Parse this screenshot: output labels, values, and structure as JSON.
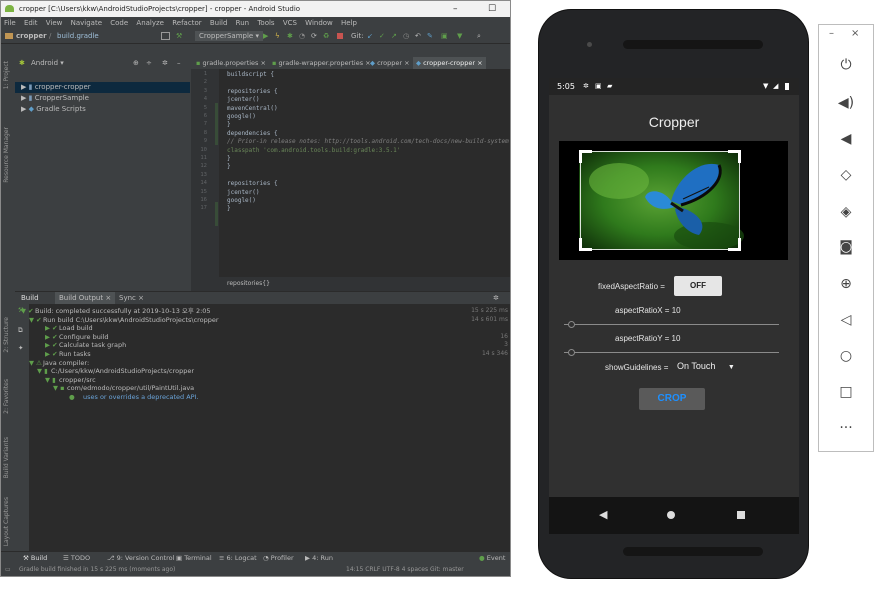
{
  "ide": {
    "window_title": "cropper [C:\\Users\\kkw\\AndroidStudioProjects\\cropper] - cropper - Android Studio",
    "minimize": "–",
    "maximize": "☐",
    "menu": [
      "File",
      "Edit",
      "View",
      "Navigate",
      "Code",
      "Analyze",
      "Refactor",
      "Build",
      "Run",
      "Tools",
      "VCS",
      "Window",
      "Help"
    ],
    "nav": {
      "project": "cropper",
      "file": "build.gradle",
      "run_config": "CropperSample"
    },
    "project_view": "Android",
    "tree": [
      {
        "label": "cropper-cropper",
        "selected": true
      },
      {
        "label": "CropperSample",
        "selected": false
      },
      {
        "label": "Gradle Scripts",
        "selected": false
      }
    ],
    "tabs": [
      "gradle.properties",
      "gradle-wrapper.properties",
      "cropper",
      "cropper-cropper"
    ],
    "side_labels": [
      "1: Project",
      "Resource Manager",
      "2: Structure",
      "2: Favorites",
      "Build Variants",
      "Layout Captures"
    ],
    "code_lines": [
      {
        "n": "1",
        "text": "buildscript {"
      },
      {
        "n": "2",
        "text": ""
      },
      {
        "n": "3",
        "text": "    repositories {"
      },
      {
        "n": "4",
        "text": "        jcenter()"
      },
      {
        "n": "5",
        "text": "        mavenCentral()"
      },
      {
        "n": "6",
        "text": "        google()"
      },
      {
        "n": "7",
        "text": "    }"
      },
      {
        "n": "8",
        "text": "    dependencies {"
      },
      {
        "n": "9",
        "text": "        // Prior-in release notes: http://tools.android.com/tech-docs/new-build-system"
      },
      {
        "n": "10",
        "text": "        classpath 'com.android.tools.build:gradle:3.5.1'"
      },
      {
        "n": "11",
        "text": "    }"
      },
      {
        "n": "12",
        "text": "}"
      },
      {
        "n": "13",
        "text": ""
      },
      {
        "n": "14",
        "text": "repositories {"
      },
      {
        "n": "15",
        "text": "    jcenter()"
      },
      {
        "n": "16",
        "text": "    google()"
      },
      {
        "n": "17",
        "text": "}"
      }
    ],
    "breadcrumb": "repositories{}",
    "build_tabs": [
      "Build",
      "Build Output",
      "Sync"
    ],
    "build_lines": [
      {
        "text": "Build: completed successfully at 2019-10-13 오후 2:05",
        "time": "15 s 225 ms"
      },
      {
        "text": "Run build C:\\Users\\kkw\\AndroidStudioProjects\\cropper",
        "time": "14 s 601 ms"
      },
      {
        "text": "Load build",
        "time": ""
      },
      {
        "text": "Configure build",
        "time": "16"
      },
      {
        "text": "Calculate task graph",
        "time": "3"
      },
      {
        "text": "Run tasks",
        "time": "14 s 346"
      },
      {
        "text": "Java compiler:",
        "time": ""
      },
      {
        "text": "C:/Users/kkw/AndroidStudioProjects/cropper",
        "time": ""
      },
      {
        "text": "cropper/src",
        "time": ""
      },
      {
        "text": "com/edmodo/cropper/util/PaintUtil.java",
        "time": ""
      },
      {
        "text": "uses or overrides a deprecated API.",
        "time": ""
      }
    ],
    "bottom_tabs": [
      "Build",
      "TODO",
      "9: Version Control",
      "Terminal",
      "6: Logcat",
      "Profiler",
      "4: Run"
    ],
    "event_log": "Event",
    "status_text": "Gradle build finished in 15 s 225 ms (moments ago)",
    "status_right": "14:15  CRLF  UTF-8  4 spaces  Git: master"
  },
  "phone": {
    "time": "5:05",
    "app_title": "Cropper",
    "fixed_aspect_label": "fixedAspectRatio =",
    "fixed_aspect_value": "OFF",
    "aspect_x_label": "aspectRatioX = 10",
    "aspect_y_label": "aspectRatioY = 10",
    "guidelines_label": "showGuidelines =",
    "guidelines_value": "On Touch",
    "crop_label": "CROP"
  },
  "emulator_toolbar": {
    "minimize": "–",
    "close": "×",
    "buttons": [
      "power-icon",
      "volume-up-icon",
      "volume-down-icon",
      "rotate-left-icon",
      "rotate-right-icon",
      "camera-icon",
      "zoom-icon",
      "back-icon",
      "home-icon",
      "overview-icon",
      "more-icon"
    ]
  },
  "colors": {
    "ide_bg": "#3c3f41",
    "editor_bg": "#2b2b2b",
    "phone_screen": "#303030",
    "crop_text": "#1e90ff"
  }
}
